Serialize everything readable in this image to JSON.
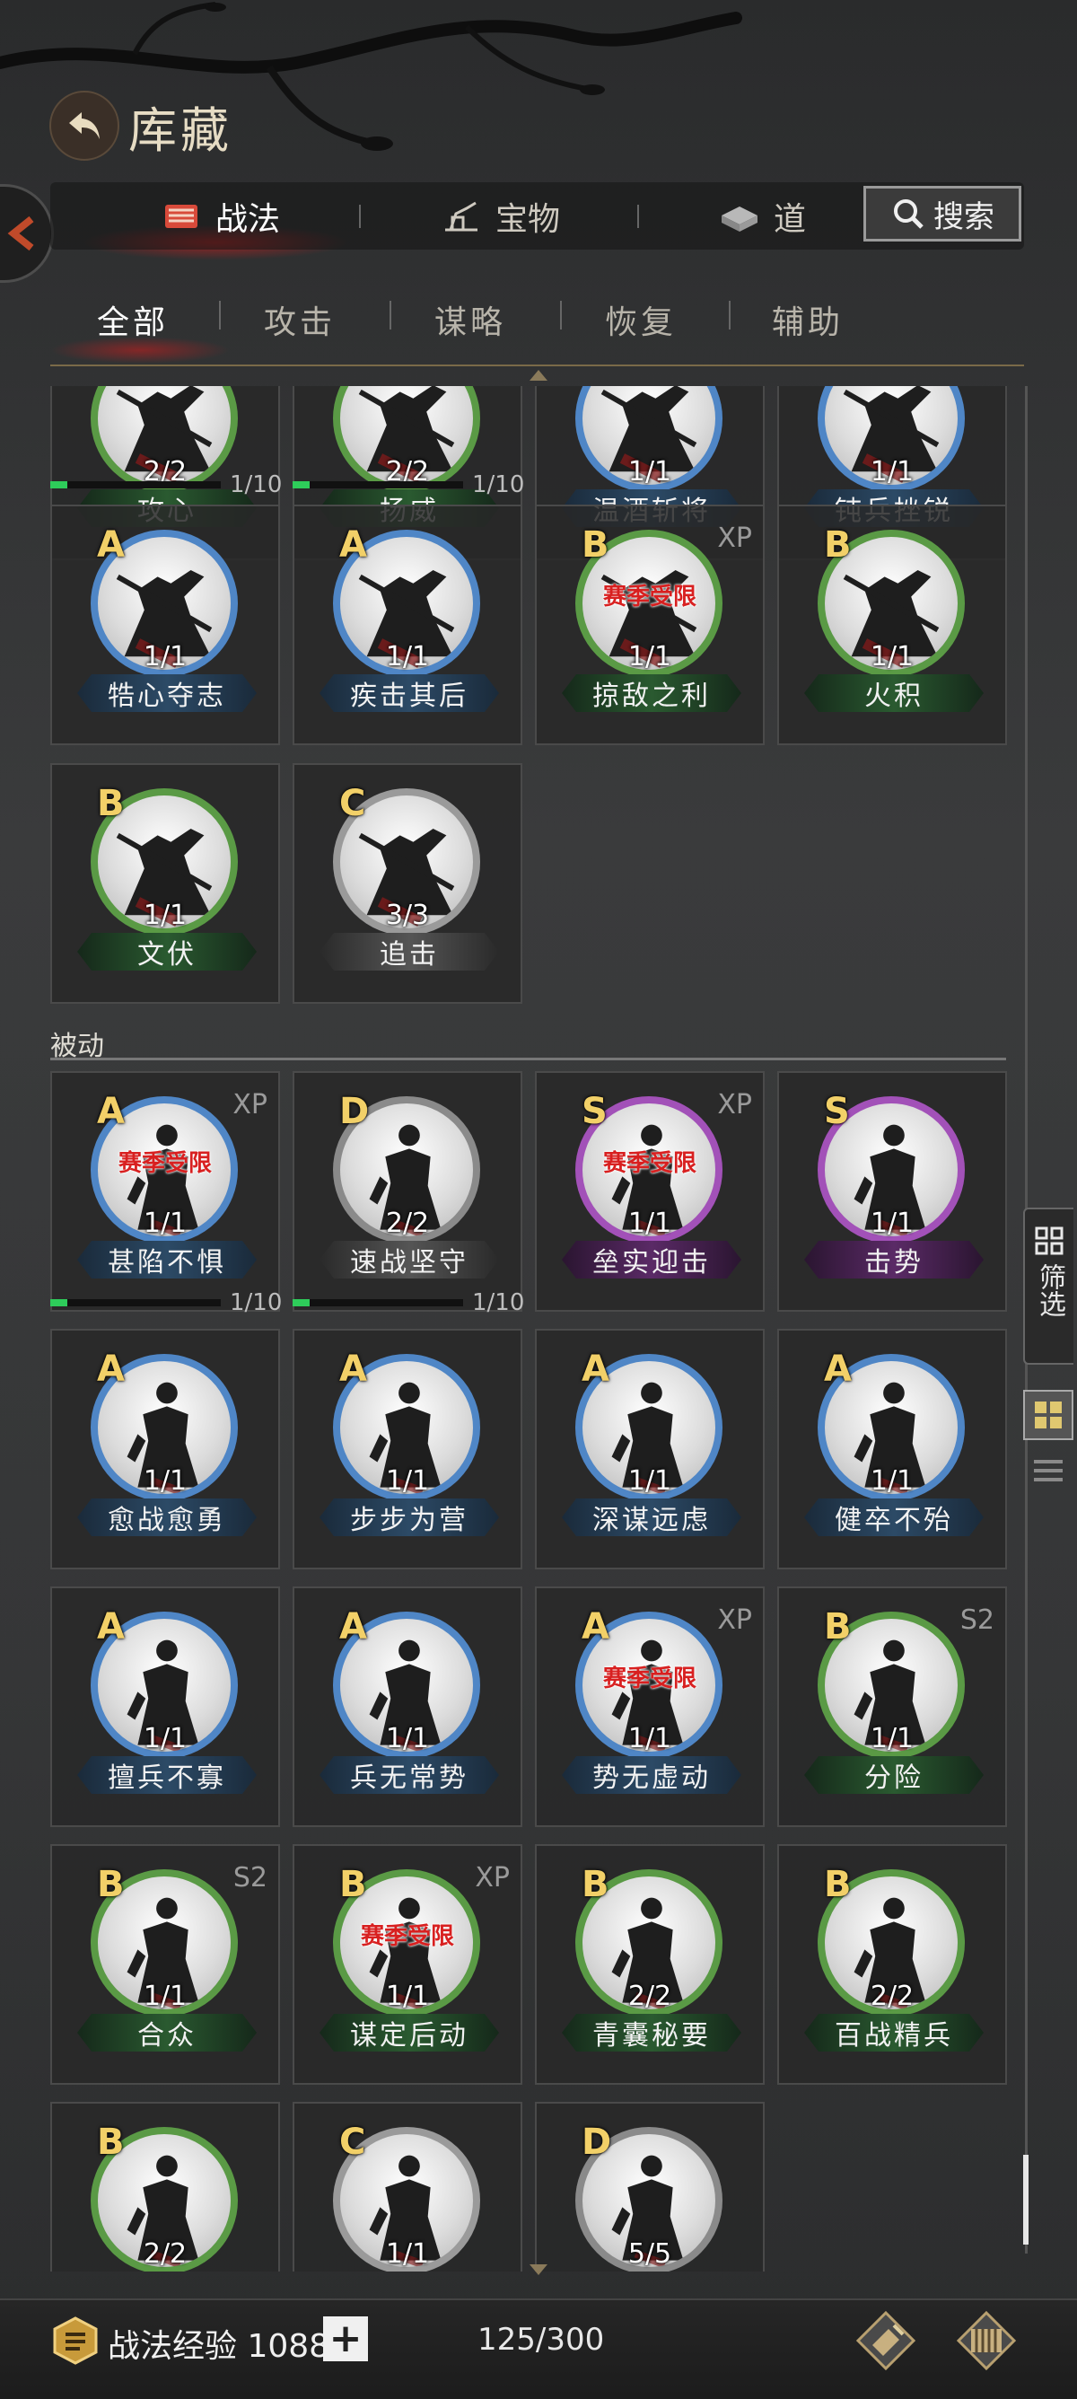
{
  "header": {
    "title": "库藏"
  },
  "top_tabs": [
    {
      "label": "战法",
      "icon": "scroll-icon",
      "active": true
    },
    {
      "label": "宝物",
      "icon": "treasure-icon",
      "active": false
    },
    {
      "label": "道",
      "icon": "item-icon",
      "active": false
    }
  ],
  "search": {
    "label": "搜索"
  },
  "sub_tabs": [
    {
      "label": "全部",
      "active": true
    },
    {
      "label": "攻击",
      "active": false
    },
    {
      "label": "谋略",
      "active": false
    },
    {
      "label": "恢复",
      "active": false
    },
    {
      "label": "辅助",
      "active": false
    }
  ],
  "cut_row": [
    {
      "name": "攻心",
      "count": "2/2",
      "progress": "1/10",
      "fill": 0.1,
      "plate": "B"
    },
    {
      "name": "扬威",
      "count": "2/2",
      "progress": "1/10",
      "fill": 0.1,
      "plate": "B"
    },
    {
      "name": "温酒斩将",
      "count": "1/1",
      "plate": "A"
    },
    {
      "name": "钝兵挫锐",
      "count": "1/1",
      "plate": "A"
    }
  ],
  "active_cards": [
    {
      "grade": "A",
      "name": "牿心夺志",
      "count": "1/1"
    },
    {
      "grade": "A",
      "name": "疾击其后",
      "count": "1/1"
    },
    {
      "grade": "B",
      "name": "掠敌之利",
      "count": "1/1",
      "tag": "XP",
      "season": "赛季受限"
    },
    {
      "grade": "B",
      "name": "火积",
      "count": "1/1"
    },
    {
      "grade": "B",
      "name": "文伏",
      "count": "1/1"
    },
    {
      "grade": "C",
      "name": "追击",
      "count": "3/3"
    }
  ],
  "passive_section": {
    "label": "被动"
  },
  "passive_cards": [
    {
      "grade": "A",
      "name": "甚陷不惧",
      "count": "1/1",
      "tag": "XP",
      "season": "赛季受限",
      "progress": "1/10",
      "fill": 0.1
    },
    {
      "grade": "D",
      "name": "速战坚守",
      "count": "2/2",
      "progress": "1/10",
      "fill": 0.1
    },
    {
      "grade": "S",
      "name": "垒实迎击",
      "count": "1/1",
      "tag": "XP",
      "season": "赛季受限"
    },
    {
      "grade": "S",
      "name": "击势",
      "count": "1/1"
    },
    {
      "grade": "A",
      "name": "愈战愈勇",
      "count": "1/1"
    },
    {
      "grade": "A",
      "name": "步步为营",
      "count": "1/1"
    },
    {
      "grade": "A",
      "name": "深谋远虑",
      "count": "1/1"
    },
    {
      "grade": "A",
      "name": "健卒不殆",
      "count": "1/1"
    },
    {
      "grade": "A",
      "name": "擅兵不寡",
      "count": "1/1"
    },
    {
      "grade": "A",
      "name": "兵无常势",
      "count": "1/1"
    },
    {
      "grade": "A",
      "name": "势无虚动",
      "count": "1/1",
      "tag": "XP",
      "season": "赛季受限"
    },
    {
      "grade": "B",
      "name": "分险",
      "count": "1/1",
      "tag": "S2"
    },
    {
      "grade": "B",
      "name": "合众",
      "count": "1/1",
      "tag": "S2"
    },
    {
      "grade": "B",
      "name": "谋定后动",
      "count": "1/1",
      "tag": "XP",
      "season": "赛季受限"
    },
    {
      "grade": "B",
      "name": "青囊秘要",
      "count": "2/2"
    },
    {
      "grade": "B",
      "name": "百战精兵",
      "count": "2/2"
    },
    {
      "grade": "B",
      "name": "",
      "count": "2/2"
    },
    {
      "grade": "C",
      "name": "",
      "count": "1/1"
    },
    {
      "grade": "D",
      "name": "",
      "count": "5/5"
    }
  ],
  "side": {
    "filter_label": "筛选"
  },
  "footer": {
    "exp_label": "战法经验 1088",
    "plus": "+",
    "capacity": "125/300"
  },
  "colors": {
    "grade_A": "#4f86c6",
    "grade_B": "#5a9a45",
    "grade_C": "#9a9a9a",
    "grade_D": "#8a8a8a",
    "grade_S": "#a251b8",
    "grade_letter": "#f2d068",
    "season_text": "#d82020",
    "progress_fill": "#2ecc5a"
  }
}
